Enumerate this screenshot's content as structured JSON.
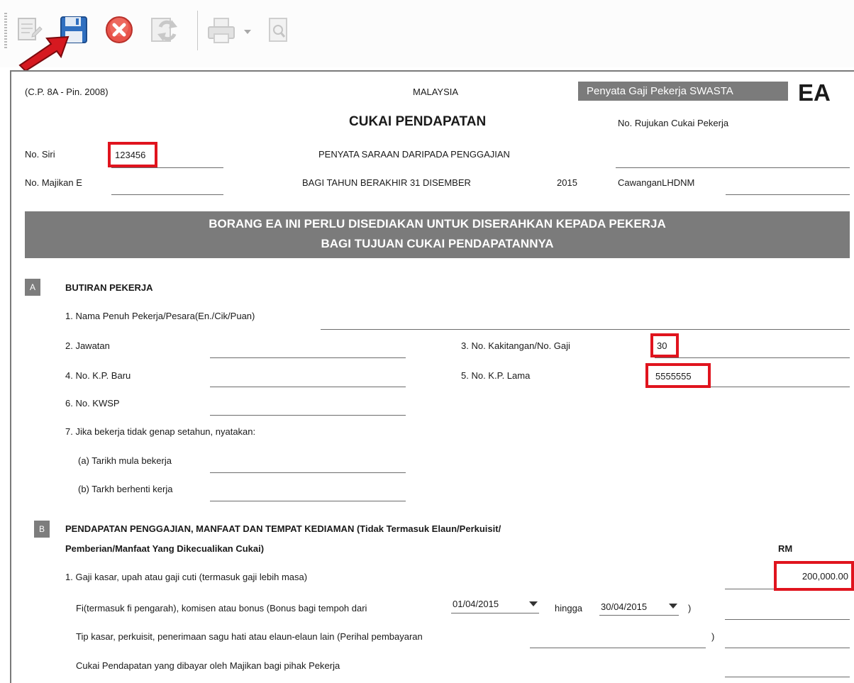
{
  "toolbar": {
    "icons": [
      "edit-document-icon",
      "save-icon",
      "cancel-icon",
      "refresh-icon",
      "print-icon",
      "print-dropdown-icon",
      "preview-icon"
    ]
  },
  "header": {
    "form_code": "(C.P. 8A - Pin. 2008)",
    "country": "MALAYSIA",
    "form_type_label": "Penyata Gaji Pekerja SWASTA",
    "form_id": "EA",
    "title": "CUKAI PENDAPATAN",
    "employee_tax_ref_label": "No. Rujukan Cukai Pekerja",
    "serial_label": "No. Siri",
    "serial_value": "123456",
    "subtitle": "PENYATA SARAAN DARIPADA PENGGAJIAN",
    "employer_no_label": "No. Majikan E",
    "year_label": "BAGI TAHUN BERAKHIR 31 DISEMBER",
    "year_value": "2015",
    "branch_label": "CawanganLHDNM"
  },
  "banner": {
    "line1": "BORANG EA INI PERLU DISEDIAKAN UNTUK DISERAHKAN KEPADA PEKERJA",
    "line2": "BAGI TUJUAN CUKAI PENDAPATANNYA"
  },
  "section_a": {
    "badge": "A",
    "title": "BUTIRAN PEKERJA",
    "full_name_label": "1. Nama Penuh Pekerja/Pesara(En./Cik/Puan)",
    "position_label": "2. Jawatan",
    "staff_no_label": "3. No. Kakitangan/No. Gaji",
    "staff_no_value": "30",
    "new_ic_label": "4. No. K.P. Baru",
    "old_ic_label": "5. No. K.P. Lama",
    "old_ic_value": "5555555",
    "kwsp_label": "6. No. KWSP",
    "partial_year_label": "7. Jika bekerja tidak genap setahun, nyatakan:",
    "start_date_label": "(a) Tarikh mula bekerja",
    "end_date_label": "(b) Tarkh berhenti kerja"
  },
  "section_b": {
    "badge": "B",
    "title_line1": "PENDAPATAN PENGGAJIAN, MANFAAT DAN TEMPAT KEDIAMAN (Tidak Termasuk Elaun/Perkuisit/",
    "title_line2": "Pemberian/Manfaat Yang Dikecualikan Cukai)",
    "currency_header": "RM",
    "gross_salary_label": "1. Gaji kasar, upah atau gaji cuti (termasuk gaji lebih masa)",
    "gross_salary_value": "200,000.00",
    "fees_label": "Fi(termasuk fi pengarah), komisen atau bonus (Bonus bagi tempoh dari",
    "fees_from": "01/04/2015",
    "fees_to_label": "hingga",
    "fees_to": "30/04/2015",
    "fees_close": ")",
    "tips_label": "Tip kasar, perkuisit, penerimaan sagu hati atau elaun-elaun lain (Perihal pembayaran",
    "tips_close": ")",
    "tax_paid_label": "Cukai Pendapatan yang dibayar oleh Majikan bagi pihak Pekerja"
  }
}
